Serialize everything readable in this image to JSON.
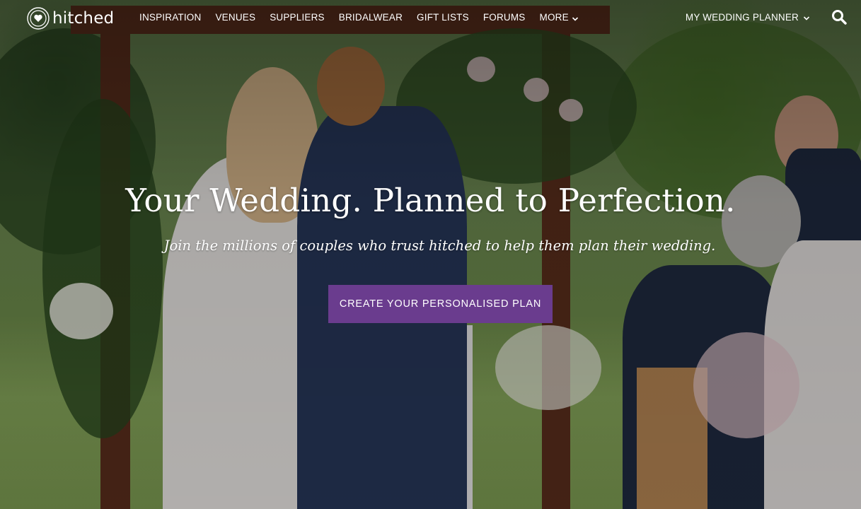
{
  "brand": {
    "name": "hitched"
  },
  "nav": {
    "items": [
      {
        "label": "INSPIRATION"
      },
      {
        "label": "VENUES"
      },
      {
        "label": "SUPPLIERS"
      },
      {
        "label": "BRIDALWEAR"
      },
      {
        "label": "GIFT LISTS"
      },
      {
        "label": "FORUMS"
      },
      {
        "label": "MORE"
      }
    ],
    "planner_label": "MY WEDDING PLANNER"
  },
  "hero": {
    "headline": "Your Wedding. Planned to Perfection.",
    "subheadline": "Join the millions of couples who trust hitched to help them plan their wedding.",
    "cta_label": "CREATE YOUR PERSONALISED PLAN"
  },
  "colors": {
    "cta_background": "#6a3c8e",
    "text": "#ffffff"
  },
  "icons": {
    "logo": "heart-circle-logo-icon",
    "more_chevron": "chevron-down-icon",
    "planner_chevron": "chevron-down-icon",
    "search": "search-icon"
  }
}
